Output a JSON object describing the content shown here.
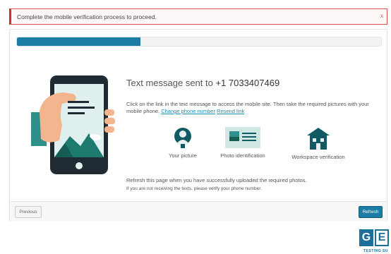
{
  "alert": {
    "message": "Complete the mobile verification process to proceed.",
    "close": "x"
  },
  "progress": {
    "value": 0.34
  },
  "main": {
    "heading_prefix": "Text message sent to ",
    "phone_number": "+1 7033407469",
    "desc_text": "Click on the link in the text message to access the mobile site. Then take the required pictures with your mobile phone.",
    "change_link": "Change phone number",
    "resend_link": "Resend link",
    "requirements": [
      {
        "label": "Your picture",
        "icon": "person-icon"
      },
      {
        "label": "Photo identification",
        "icon": "id-card-icon"
      },
      {
        "label": "Workspace verification",
        "icon": "building-icon"
      }
    ],
    "refresh_note": "Refresh this page when you have successfully uploaded the required photos.",
    "hint": "If you are not receiving the texts, please verify your phone number."
  },
  "footer": {
    "previous": "Previous",
    "refresh": "Refresh"
  },
  "logo": {
    "letters": [
      "G",
      "E"
    ],
    "text": "TESTING SU"
  },
  "colors": {
    "accent": "#1b7da3",
    "alert_border": "#d9534f",
    "teal_dark": "#0f6b72",
    "teal_mid": "#2f8f8a"
  }
}
